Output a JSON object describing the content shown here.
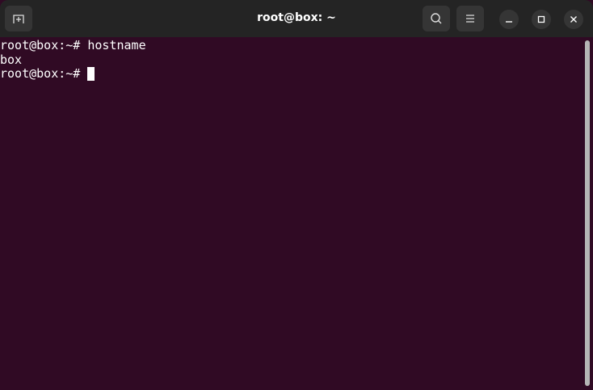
{
  "window": {
    "title": "root@box: ~"
  },
  "terminal": {
    "lines": [
      "root@box:~# hostname",
      "box"
    ],
    "prompt": "root@box:~# "
  }
}
